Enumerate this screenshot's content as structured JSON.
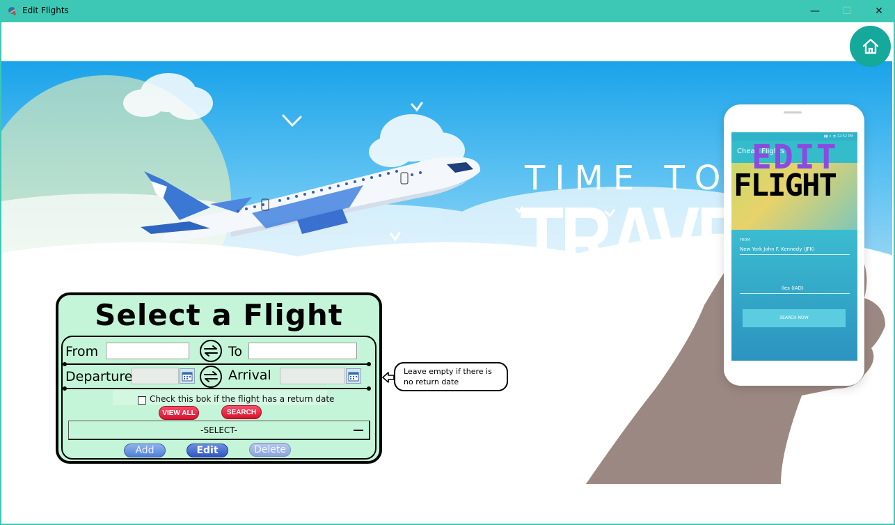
{
  "window": {
    "title": "Edit Flights",
    "minimize_glyph": "—",
    "maximize_glyph": "☐",
    "close_glyph": "✕"
  },
  "banner": {
    "headline_top": "TIME TO",
    "headline_main": "TRAVEL",
    "phone": {
      "app_title": "Cheap Flights",
      "overlay_top": "EDIT",
      "overlay_bottom": "FLIGHT",
      "from_label": "FROM",
      "from_value": "New York John F. Kennedy (JFK)",
      "to_value": "lles (IAD)",
      "search_button": "SEARCH NOW"
    }
  },
  "panel": {
    "title": "Select a Flight",
    "from_label": "From",
    "from_value": "",
    "to_label": "To",
    "to_value": "",
    "departure_label": "Departure",
    "departure_value": "",
    "arrival_label": "Arrival",
    "arrival_value": "",
    "return_checkbox_label": "Check this bok if the flight has a return date",
    "return_checked": false,
    "view_all_button": "VIEW ALL",
    "search_button": "SEARCH",
    "flight_select_value": "-SELECT-",
    "add_button": "Add",
    "edit_button": "Edit",
    "delete_button": "Delete"
  },
  "tooltip": {
    "text": "Leave empty if there is no return date"
  },
  "colors": {
    "titlebar": "#3cc8b4",
    "home_button": "#14a99a",
    "panel_bg": "#c4f5d8",
    "red_button": "#d7122e",
    "blue_button": "#2f56c4"
  },
  "icons": [
    "app-icon",
    "home-icon",
    "swap-icon",
    "calendar-icon",
    "dropdown-arrow-icon"
  ]
}
